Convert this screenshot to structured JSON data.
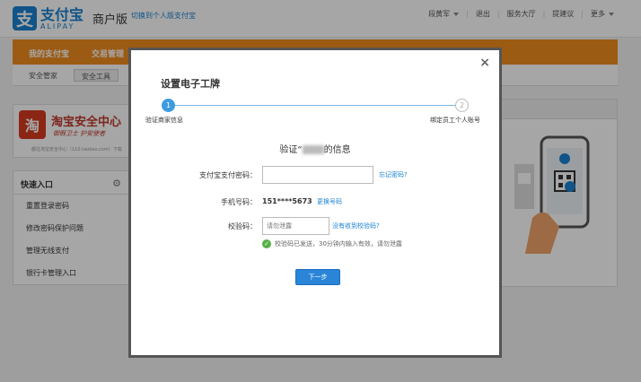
{
  "header": {
    "logo_mark": "支",
    "logo_cn": "支付宝",
    "logo_en": "ALIPAY",
    "edition": "商户版",
    "switch_link": "切换到个人版支付宝",
    "menu": [
      "段黄军",
      "退出",
      "服务大厅",
      "提建议",
      "更多"
    ]
  },
  "nav": {
    "items": [
      "我的支付宝",
      "交易管理"
    ]
  },
  "subnav": {
    "items": [
      "安全管家",
      "安全工具"
    ]
  },
  "banner": {
    "seal": "淘",
    "title": "淘宝安全中心",
    "subtitle": "御假卫士 护安使者",
    "foot": "都往淘宝安全中心（110.taobao.com）下载"
  },
  "quick": {
    "title": "快速入口",
    "items": [
      "重置登录密码",
      "修改密码保护问题",
      "管理无线支付",
      "银行卡管理入口"
    ]
  },
  "modal": {
    "close": "×",
    "title": "设置电子工牌",
    "steps": [
      {
        "number": "1",
        "label": "验证商家信息"
      },
      {
        "number": "2",
        "label": "绑定员工个人账号"
      }
    ],
    "verify_prefix": "验证“",
    "verify_suffix": "的信息",
    "password_label": "支付宝支付密码：",
    "password_value": "",
    "forgot_link": "忘记密码?",
    "phone_label": "手机号码：",
    "phone_value": "151****5673",
    "change_phone_link": "更换号码",
    "code_label": "校验码：",
    "code_placeholder": "请勿泄露",
    "no_code_link": "没有收到校验码?",
    "hint": "校验码已发送，30分钟内输入有效，请勿泄露",
    "next_button": "下一步"
  }
}
